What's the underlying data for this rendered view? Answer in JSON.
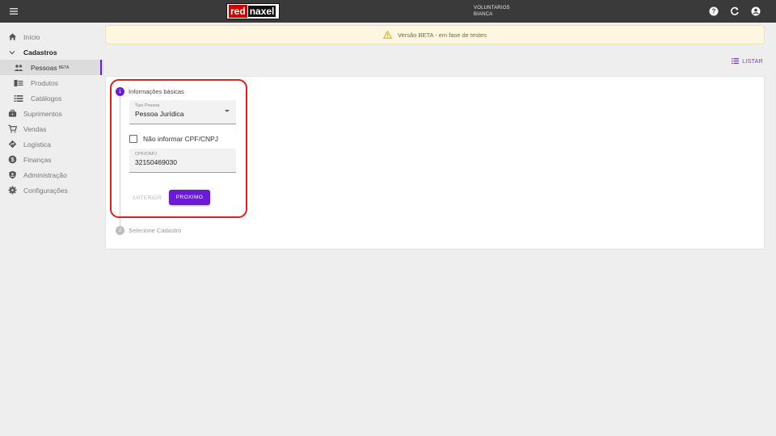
{
  "header": {
    "logo_red": "red",
    "logo_naxel": "naxel",
    "org_line1": "VOLUNTARIOS",
    "org_line2": "BIANCA",
    "icons": [
      "help-icon",
      "refresh-icon",
      "account-icon"
    ]
  },
  "sidebar": {
    "items": [
      {
        "label": "Início",
        "icon": "home-icon"
      },
      {
        "label": "Cadastros",
        "icon": "chevron-down-icon"
      },
      {
        "label": "Pessoas",
        "badge": "BETA",
        "icon": "people-icon"
      },
      {
        "label": "Produtos",
        "icon": "product-icon"
      },
      {
        "label": "Catálogos",
        "icon": "list-icon"
      },
      {
        "label": "Suprimentos",
        "icon": "briefcase-icon"
      },
      {
        "label": "Vendas",
        "icon": "cart-icon"
      },
      {
        "label": "Logística",
        "icon": "route-icon"
      },
      {
        "label": "Finanças",
        "icon": "dollar-icon"
      },
      {
        "label": "Administração",
        "icon": "shield-icon"
      },
      {
        "label": "Configurações",
        "icon": "gear-icon"
      }
    ]
  },
  "banner": {
    "text": "Versão BETA - em fase de testes"
  },
  "toolbar": {
    "listar_label": "LISTAR"
  },
  "stepper": {
    "step1": {
      "number": "1",
      "label": "Informações básicas"
    },
    "step2": {
      "number": "2",
      "label": "Selecione Cadastro"
    }
  },
  "form": {
    "tipo_pessoa": {
      "label": "Tipo Pessoa",
      "value": "Pessoa Jurídica"
    },
    "nao_informar_label": "Não informar CPF/CNPJ",
    "cpf_cnpj": {
      "label": "CPF/CNPJ",
      "value": "32150469030"
    },
    "anterior_label": "ANTERIOR",
    "proximo_label": "PROXIMO"
  },
  "colors": {
    "accent": "#6a1bd8",
    "highlight": "#e02020",
    "topbar": "#3a3a3a"
  }
}
